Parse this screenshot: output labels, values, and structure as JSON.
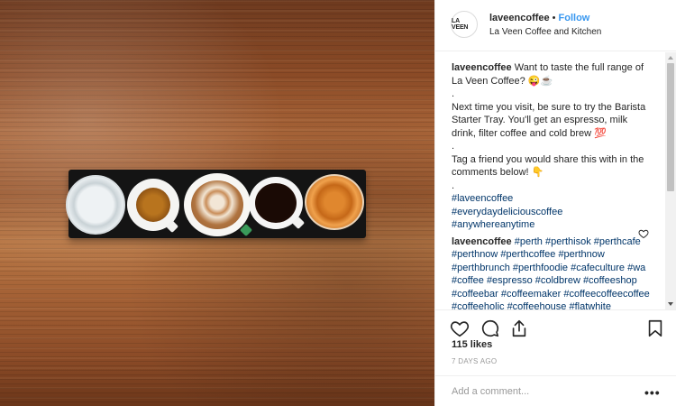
{
  "post": {
    "header": {
      "avatar_text": "LA VEEN",
      "username": "laveencoffee",
      "separator": "•",
      "follow_label": "Follow",
      "location": "La Veen Coffee and Kitchen"
    },
    "caption": {
      "username": "laveencoffee",
      "line1": "Want to taste the full range of La Veen Coffee? 😜☕",
      "dot1": ".",
      "line2": "Next time you visit, be sure to try the Barista Starter Tray. You'll get an espresso, milk drink, filter coffee and cold brew 💯",
      "dot2": ".",
      "line3": "Tag a friend you would share this with in the comments below! 👇",
      "dot3": ".",
      "hashtags": [
        "#laveencoffee",
        "#everydaydeliciouscoffee",
        "#anywhereanytime"
      ]
    },
    "comment": {
      "username": "laveencoffee",
      "tags_line1": "#perth #perthisok",
      "tags_rest": "#perthcafe #perthnow #perthcoffee #perthnow #perthbrunch #perthfoodie #cafeculture #wa #coffee #espresso #coldbrew #coffeeshop #coffeebar #coffeemaker #coffeecoffeecoffee #coffeeholic #coffeehouse #flatwhite"
    },
    "likes": "115 likes",
    "timestamp": "7 DAYS AGO",
    "add_comment_placeholder": "Add a comment...",
    "more_options": "•••",
    "icons": {
      "like": "heart-icon",
      "comment": "comment-icon",
      "share": "share-icon",
      "save": "bookmark-icon"
    }
  }
}
